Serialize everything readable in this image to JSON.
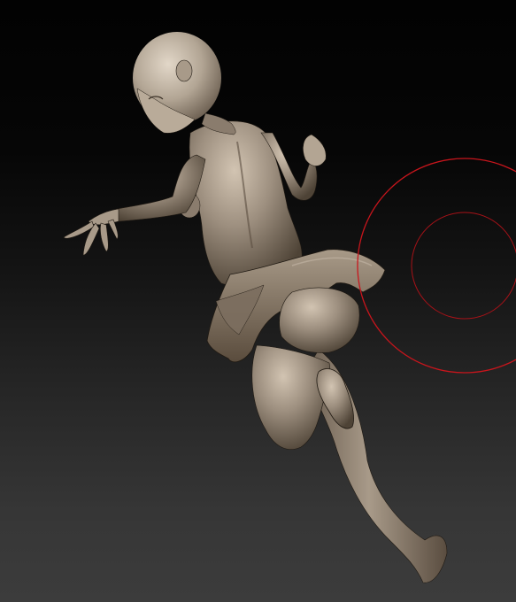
{
  "viewport": {
    "background_top": "#020202",
    "background_bottom": "#3c3c3c"
  },
  "model": {
    "material_light": "#d2c4b2",
    "material_mid": "#9d8f7f",
    "material_dark": "#4e4336",
    "outline": "#201a13"
  },
  "brush_cursor": {
    "color": "#c8151c",
    "icon": "brush-cursor-circles"
  }
}
